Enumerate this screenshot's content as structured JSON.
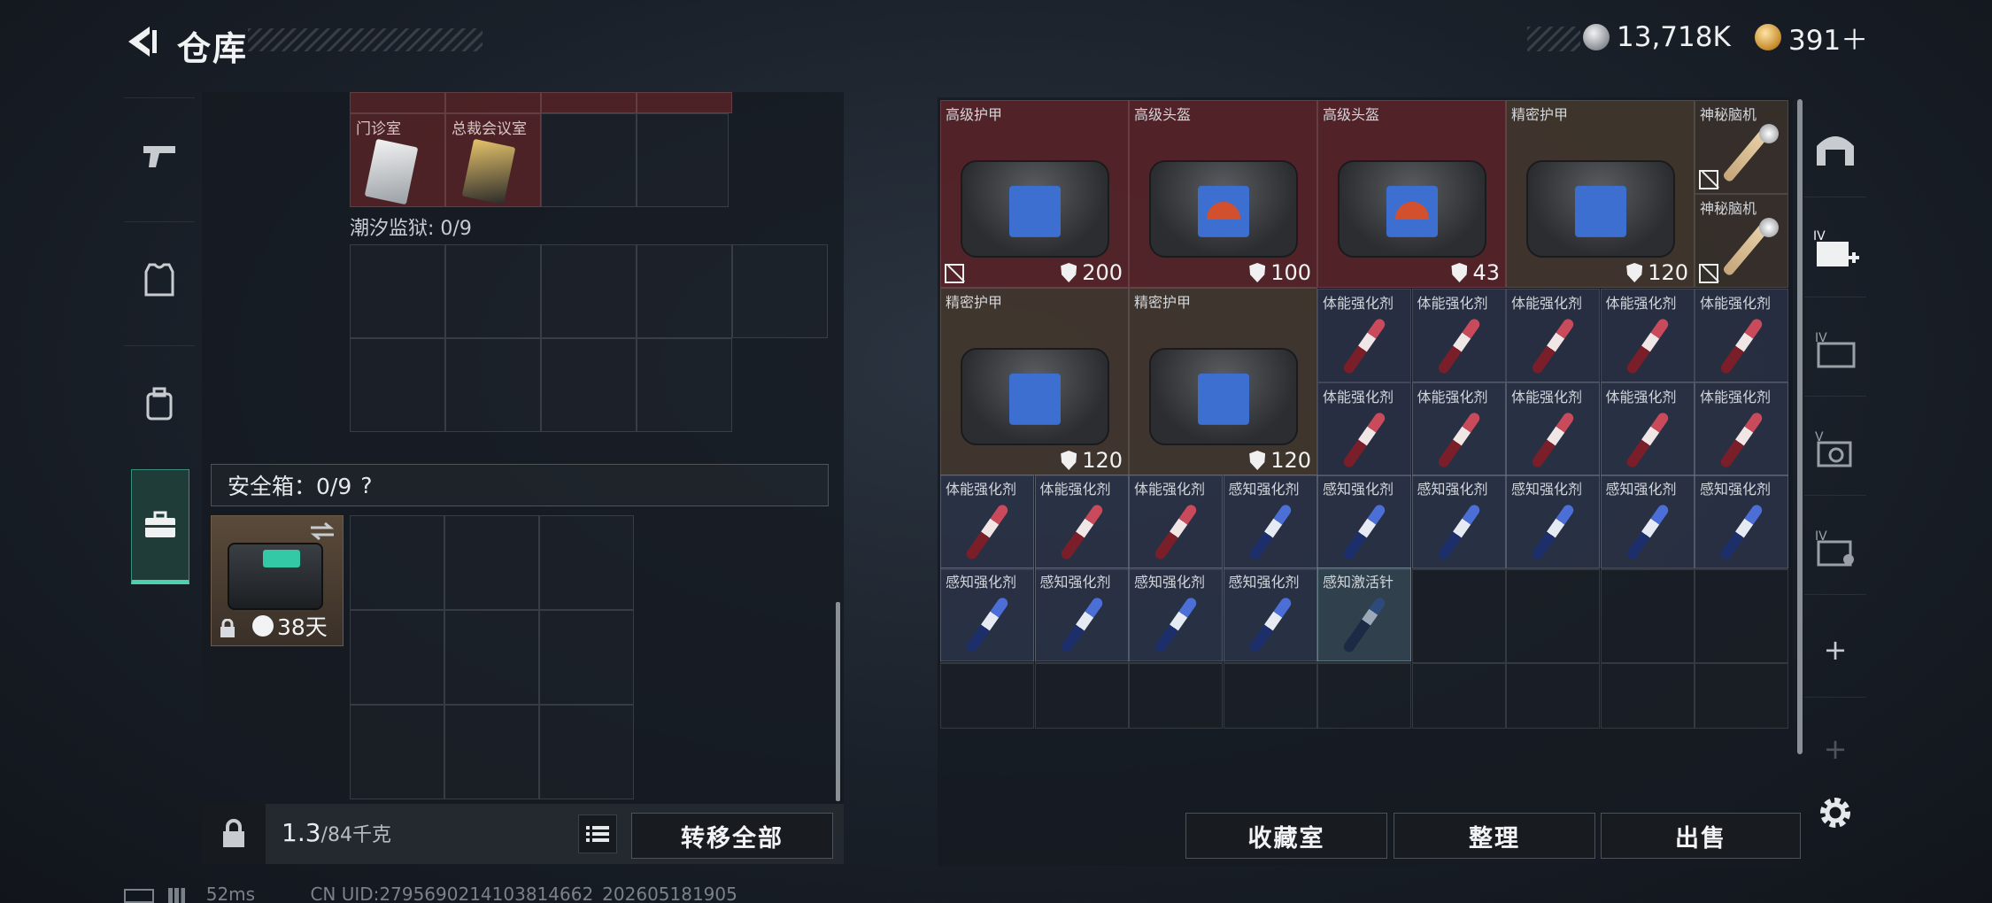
{
  "header": {
    "title": "仓库",
    "currency": [
      {
        "icon": "silver-coin-icon",
        "value": "13,718K"
      },
      {
        "icon": "gold-coin-icon",
        "value": "391＋"
      }
    ]
  },
  "left_nav": [
    "pistol-icon",
    "armor-icon",
    "backpack-icon",
    "briefcase-icon"
  ],
  "left_panel": {
    "keycards": [
      {
        "label": "门诊室"
      },
      {
        "label": "总裁会议室"
      }
    ],
    "prison_label": "潮汐监狱: 0/9",
    "safe_label": "安全箱：0/9",
    "safe_help": "?",
    "safe_days": "38天"
  },
  "bottom": {
    "weight_value": "1.3",
    "weight_max": "/84千克",
    "transfer_all": "转移全部"
  },
  "right_panel": {
    "big_items": [
      {
        "label": "高级护甲",
        "durability": "200"
      },
      {
        "label": "高级头盔",
        "durability": "100"
      },
      {
        "label": "高级头盔",
        "durability": "43"
      },
      {
        "label": "精密护甲",
        "durability": "120"
      },
      {
        "label": "精密护甲",
        "durability": "120"
      },
      {
        "label": "精密护甲",
        "durability": "120"
      }
    ],
    "mystery": "神秘脑机",
    "small_items": {
      "physical": "体能强化剂",
      "perception": "感知强化剂",
      "activation": "感知激活针"
    }
  },
  "actions": {
    "collection": "收藏室",
    "sort": "整理",
    "sell": "出售"
  },
  "right_nav": {
    "plus": "+"
  },
  "footer": {
    "ping": "52ms",
    "uid": "CN UID:2795690214103814662_202605181905"
  }
}
